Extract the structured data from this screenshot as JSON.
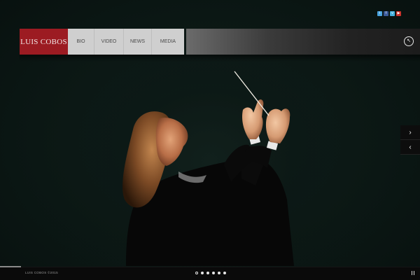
{
  "header": {
    "logo_text": "LUIS COBOS",
    "nav": [
      {
        "label": "BIO"
      },
      {
        "label": "VIDEO"
      },
      {
        "label": "NEWS"
      },
      {
        "label": "MEDIA"
      }
    ],
    "social": [
      {
        "icon": "twitter-icon",
        "color": "#4aa3df"
      },
      {
        "icon": "facebook-icon",
        "color": "#3b5b9a"
      },
      {
        "icon": "vimeo-icon",
        "color": "#44b0dd"
      },
      {
        "icon": "youtube-icon",
        "color": "#c8312a"
      }
    ]
  },
  "slideshow": {
    "next_icon": "chevron-right-icon",
    "prev_icon": "chevron-left-icon",
    "dots": [
      {
        "active": true
      },
      {
        "active": false
      },
      {
        "active": false
      },
      {
        "active": false
      },
      {
        "active": false
      },
      {
        "active": false
      }
    ]
  },
  "footer": {
    "copyright": "LUIS COBOS ©2015",
    "pause_icon": "pause-icon"
  },
  "colors": {
    "brand": "#9c1b22",
    "nav_bg": "#cfcfcf"
  }
}
